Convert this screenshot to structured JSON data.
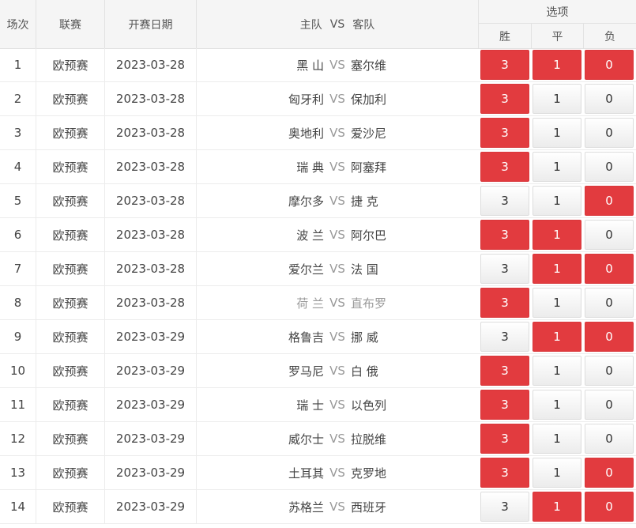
{
  "headers": {
    "num": "场次",
    "league": "联赛",
    "date": "开赛日期",
    "match_home": "主队",
    "match_vs": "VS",
    "match_away": "客队",
    "options": "选项",
    "win": "胜",
    "draw": "平",
    "lose": "负"
  },
  "colors": {
    "selected": "#e23b3f",
    "header_bg": "#f5f5f5"
  },
  "rows": [
    {
      "num": "1",
      "league": "欧预赛",
      "date": "2023-03-28",
      "home": "黑 山",
      "vs": "VS",
      "away": "塞尔维",
      "win": "3",
      "draw": "1",
      "lose": "0",
      "sel": [
        true,
        true,
        true
      ],
      "dim": false
    },
    {
      "num": "2",
      "league": "欧预赛",
      "date": "2023-03-28",
      "home": "匈牙利",
      "vs": "VS",
      "away": "保加利",
      "win": "3",
      "draw": "1",
      "lose": "0",
      "sel": [
        true,
        false,
        false
      ],
      "dim": false
    },
    {
      "num": "3",
      "league": "欧预赛",
      "date": "2023-03-28",
      "home": "奥地利",
      "vs": "VS",
      "away": "爱沙尼",
      "win": "3",
      "draw": "1",
      "lose": "0",
      "sel": [
        true,
        false,
        false
      ],
      "dim": false
    },
    {
      "num": "4",
      "league": "欧预赛",
      "date": "2023-03-28",
      "home": "瑞 典",
      "vs": "VS",
      "away": "阿塞拜",
      "win": "3",
      "draw": "1",
      "lose": "0",
      "sel": [
        true,
        false,
        false
      ],
      "dim": false
    },
    {
      "num": "5",
      "league": "欧预赛",
      "date": "2023-03-28",
      "home": "摩尔多",
      "vs": "VS",
      "away": "捷 克",
      "win": "3",
      "draw": "1",
      "lose": "0",
      "sel": [
        false,
        false,
        true
      ],
      "dim": false
    },
    {
      "num": "6",
      "league": "欧预赛",
      "date": "2023-03-28",
      "home": "波 兰",
      "vs": "VS",
      "away": "阿尔巴",
      "win": "3",
      "draw": "1",
      "lose": "0",
      "sel": [
        true,
        true,
        false
      ],
      "dim": false
    },
    {
      "num": "7",
      "league": "欧预赛",
      "date": "2023-03-28",
      "home": "爱尔兰",
      "vs": "VS",
      "away": "法 国",
      "win": "3",
      "draw": "1",
      "lose": "0",
      "sel": [
        false,
        true,
        true
      ],
      "dim": false
    },
    {
      "num": "8",
      "league": "欧预赛",
      "date": "2023-03-28",
      "home": "荷 兰",
      "vs": "VS",
      "away": "直布罗",
      "win": "3",
      "draw": "1",
      "lose": "0",
      "sel": [
        true,
        false,
        false
      ],
      "dim": true
    },
    {
      "num": "9",
      "league": "欧预赛",
      "date": "2023-03-29",
      "home": "格鲁吉",
      "vs": "VS",
      "away": "挪 威",
      "win": "3",
      "draw": "1",
      "lose": "0",
      "sel": [
        false,
        true,
        true
      ],
      "dim": false
    },
    {
      "num": "10",
      "league": "欧预赛",
      "date": "2023-03-29",
      "home": "罗马尼",
      "vs": "VS",
      "away": "白 俄",
      "win": "3",
      "draw": "1",
      "lose": "0",
      "sel": [
        true,
        false,
        false
      ],
      "dim": false
    },
    {
      "num": "11",
      "league": "欧预赛",
      "date": "2023-03-29",
      "home": "瑞 士",
      "vs": "VS",
      "away": "以色列",
      "win": "3",
      "draw": "1",
      "lose": "0",
      "sel": [
        true,
        false,
        false
      ],
      "dim": false
    },
    {
      "num": "12",
      "league": "欧预赛",
      "date": "2023-03-29",
      "home": "威尔士",
      "vs": "VS",
      "away": "拉脱维",
      "win": "3",
      "draw": "1",
      "lose": "0",
      "sel": [
        true,
        false,
        false
      ],
      "dim": false
    },
    {
      "num": "13",
      "league": "欧预赛",
      "date": "2023-03-29",
      "home": "土耳其",
      "vs": "VS",
      "away": "克罗地",
      "win": "3",
      "draw": "1",
      "lose": "0",
      "sel": [
        true,
        false,
        true
      ],
      "dim": false
    },
    {
      "num": "14",
      "league": "欧预赛",
      "date": "2023-03-29",
      "home": "苏格兰",
      "vs": "VS",
      "away": "西班牙",
      "win": "3",
      "draw": "1",
      "lose": "0",
      "sel": [
        false,
        true,
        true
      ],
      "dim": false
    }
  ]
}
